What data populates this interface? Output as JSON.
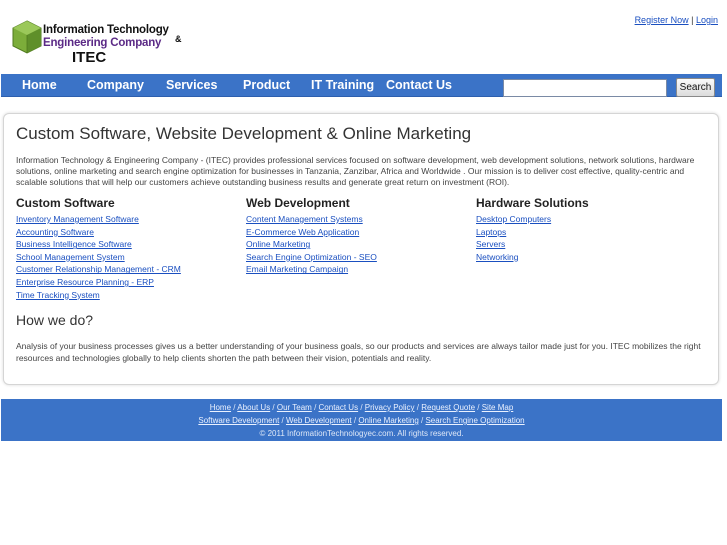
{
  "header": {
    "logo": {
      "line1": "Information Technology",
      "amp": "&",
      "line2": "Engineering Company",
      "line3": "ITEC"
    },
    "top_links": {
      "register": "Register Now",
      "separator": "|",
      "login": "Login"
    }
  },
  "nav": {
    "items": [
      {
        "label": "Home"
      },
      {
        "label": "Company"
      },
      {
        "label": "Services"
      },
      {
        "label": "Product"
      },
      {
        "label": "IT Training"
      },
      {
        "label": "Contact Us"
      }
    ],
    "search": {
      "value": "",
      "button_label": "Search"
    }
  },
  "main": {
    "title": "Custom Software, Website Development & Online Marketing",
    "intro": "Information Technology & Engineering Company - (ITEC) provides professional services focused on software development, web development solutions, network solutions, hardware solutions, online marketing and search engine optimization for businesses in Tanzania, Zanzibar, Africa and Worldwide . Our mission is to deliver cost effective, quality-centric and scalable solutions that will help our customers achieve outstanding business results and generate great return on investment (ROI).",
    "columns": [
      {
        "heading": "Custom Software",
        "links": [
          "Inventory Management Software",
          "Accounting Software",
          "Business Intelligence Software",
          "School Management System",
          "Customer Relationship Management - CRM",
          "Enterprise Resource Planning - ERP",
          "Time Tracking System"
        ]
      },
      {
        "heading": "Web Development",
        "links": [
          "Content Management Systems",
          "E-Commerce Web Application",
          "Online Marketing",
          "Search Engine Optimization - SEO",
          "Email Marketing Campaign"
        ]
      },
      {
        "heading": "Hardware Solutions",
        "links": [
          "Desktop Computers",
          "Laptops",
          "Servers",
          "Networking"
        ]
      }
    ],
    "how_title": "How we do?",
    "how_text": "Analysis of your business processes gives us a better understanding of your business goals, so our products and services are always tailor made just for you. ITEC mobilizes the right resources and technologies globally to help clients shorten the path between their vision, potentials and reality."
  },
  "footer": {
    "separator": " / ",
    "row1": [
      "Home",
      "About Us",
      "Our Team",
      "Contact Us",
      "Privacy Policy",
      "Request Quote",
      "Site Map"
    ],
    "row2": [
      "Software Development",
      "Web Development",
      "Online Marketing",
      "Search Engine Optimization"
    ],
    "copyright": "© 2011 InformationTechnologyec.com. All rights reserved."
  },
  "colors": {
    "nav_background": "#3b73c7",
    "link": "#1a4fc0",
    "logo_green": "#7cad3a",
    "logo_purple": "#5b2a86"
  },
  "icons": {
    "logo_mark": "green-cube-logo-icon"
  }
}
